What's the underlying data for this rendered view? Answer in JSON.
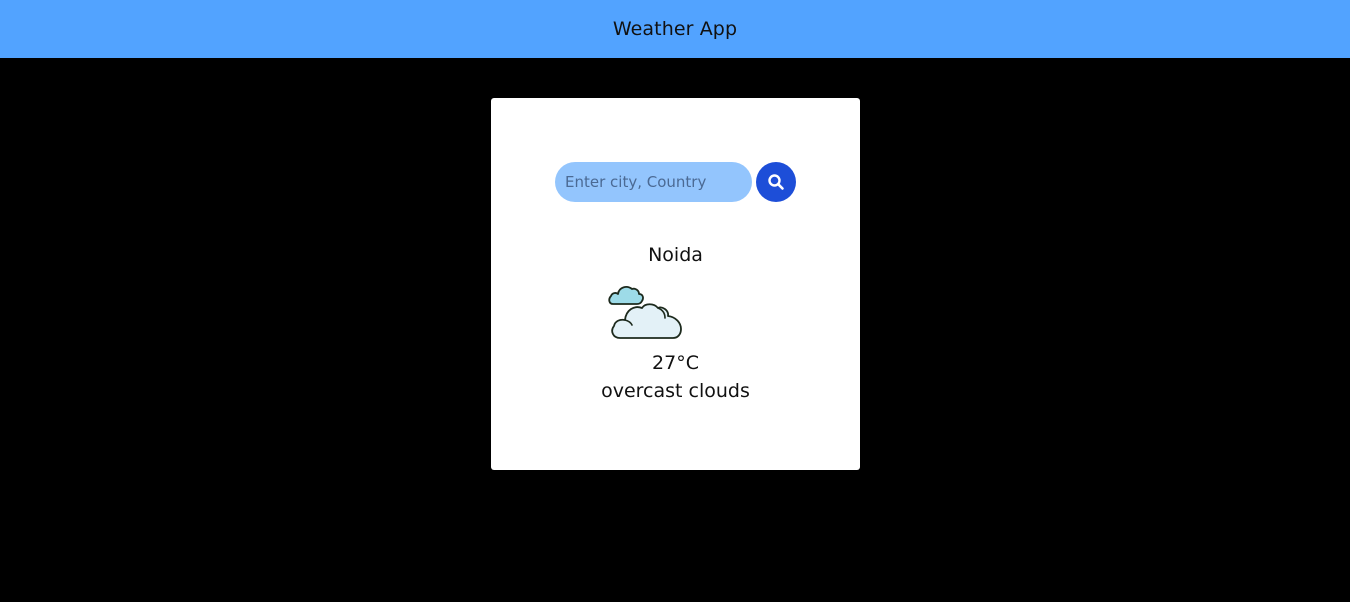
{
  "header": {
    "title": "Weather App",
    "background_color": "#52a3ff"
  },
  "search": {
    "placeholder": "Enter city, Country",
    "value": "",
    "button_icon": "search-icon"
  },
  "weather": {
    "city": "Noida",
    "icon": "overcast-clouds-icon",
    "temperature": "27°C",
    "description": "overcast clouds"
  },
  "colors": {
    "page_background": "#000000",
    "card_background": "#ffffff",
    "input_background": "#93c5fd",
    "button_background": "#1d4ed8"
  }
}
